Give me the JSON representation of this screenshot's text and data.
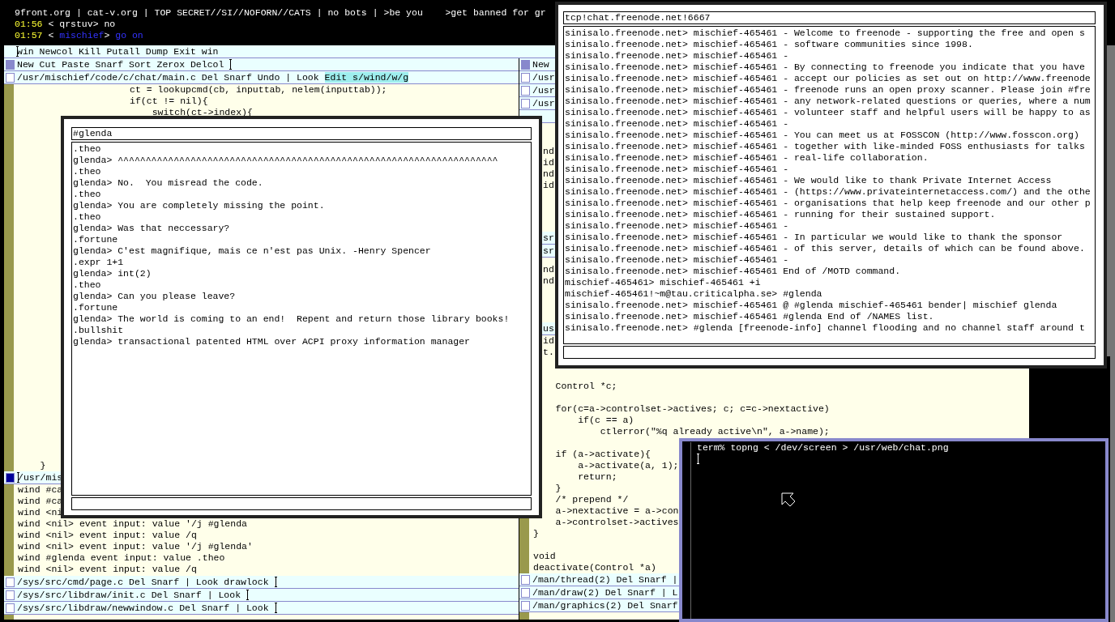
{
  "status_window": {
    "lines": [
      {
        "kind": "topic",
        "text": "9front.org | cat-v.org | TOP SECRET//SI//NOFORN//CATS | no bots | >be you    >get banned for gr"
      },
      {
        "kind": "message",
        "time": "01:56",
        "open": "<",
        "nick": "qrstuv",
        "close": ">",
        "text": "no",
        "self": false
      },
      {
        "kind": "message",
        "time": "01:57",
        "open": "<",
        "nick": "mischief",
        "close": ">",
        "text": "go on",
        "self": true
      }
    ]
  },
  "acme": {
    "tag": {
      "text": "win Newcol Kill Putall Dump Exit win",
      "cursor_before": true
    },
    "columns": [
      {
        "tag": {
          "text": "New Cut Paste Snarf Sort Zerox Delcol",
          "cursor_after": true
        },
        "windows": [
          {
            "tag": {
              "text": "/usr/mischief/code/c/chat/main.c Del Snarf Undo | Look",
              "selection": "Edit s/wind/w/g"
            },
            "dirty": false,
            "lines": [
              "\t\t\t\t\tct = lookupcmd(cb, inputtab, nelem(inputtab));",
              "\t\t\t\t\tif(ct != nil){",
              "\t\t\t\t\t\tswitch(ct->index){"
            ],
            "lines_below": [
              "\t}"
            ]
          },
          {
            "tag": {
              "text": "/usr/mis",
              "cursor_before": true
            },
            "dirty": true,
            "lines": [
              "wind #ca",
              "wind #ca",
              "wind <ni",
              "wind <nil> event input: value '/j #glenda",
              "wind <nil> event input: value /q",
              "wind <nil> event input: value '/j #glenda'",
              "wind #glenda event input: value .theo",
              "wind <nil> event input: value /q"
            ]
          },
          {
            "tag": {
              "text": "/sys/src/cmd/page.c Del Snarf | Look drawlock",
              "cursor_after": true
            },
            "dirty": false
          },
          {
            "tag": {
              "text": "/sys/src/libdraw/init.c Del Snarf | Look",
              "cursor_after": true
            },
            "dirty": false
          },
          {
            "tag": {
              "text": "/sys/src/libdraw/newwindow.c Del Snarf | Look",
              "cursor_after": true
            },
            "dirty": false
          }
        ]
      },
      {
        "tag": {
          "text": "New"
        },
        "windows": [
          {
            "tag": {
              "text": "/usr"
            },
            "dirty": false
          },
          {
            "tag": {
              "text": "/usr"
            },
            "dirty": false
          },
          {
            "tag": {
              "text": "/usr"
            },
            "dirty": false
          },
          {
            "lines": [
              {
                "kind": "fragment",
                "text": "nd"
              },
              {
                "kind": "fragment",
                "text": "id"
              },
              {
                "kind": "fragment",
                "text": "nd"
              },
              {
                "kind": "fragment",
                "text": "id"
              }
            ]
          },
          {
            "tag": {
              "text": "sr"
            }
          },
          {
            "tag": {
              "text": "sr"
            },
            "lines": [
              {
                "kind": "fragment",
                "text": "nd"
              },
              {
                "kind": "fragment",
                "text": "nd"
              }
            ]
          },
          {
            "tag": {
              "text": "us"
            },
            "lines": [
              {
                "kind": "fragment",
                "text": "id"
              },
              {
                "kind": "fragment",
                "text": "t."
              },
              {
                "kind": "blank"
              },
              {
                "kind": "blank"
              },
              {
                "kind": "code",
                "text": "\tControl *c;"
              },
              {
                "kind": "blank"
              },
              {
                "kind": "code",
                "text": "\tfor(c=a->controlset->actives; c; c=c->nextactive)"
              },
              {
                "kind": "code",
                "text": "\t\tif(c == a)"
              },
              {
                "kind": "code",
                "text": "\t\t\tctlerror(\"%q already active\\n\", a->name);"
              },
              {
                "kind": "blank"
              },
              {
                "kind": "code",
                "text": "\tif (a->activate){"
              },
              {
                "kind": "code",
                "text": "\t\ta->activate(a, 1);"
              },
              {
                "kind": "code",
                "text": "\t\treturn;"
              },
              {
                "kind": "code",
                "text": "\t}"
              },
              {
                "kind": "code",
                "text": "\t/* prepend */"
              },
              {
                "kind": "code",
                "text": "\ta->nextactive = a->con"
              },
              {
                "kind": "code",
                "text": "\ta->controlset->actives"
              },
              {
                "kind": "code",
                "text": "}"
              },
              {
                "kind": "blank"
              },
              {
                "kind": "code",
                "text": "void"
              },
              {
                "kind": "code",
                "text": "deactivate(Control *a)"
              }
            ]
          },
          {
            "tag": {
              "text": "/man/thread(2) Del Snarf |"
            },
            "dirty": false
          },
          {
            "tag": {
              "text": "/man/draw(2) Del Snarf | L"
            },
            "dirty": false
          },
          {
            "tag": {
              "text": "/man/graphics(2) Del Snarf"
            },
            "dirty": false
          }
        ]
      }
    ]
  },
  "glenda_window": {
    "title": "#glenda",
    "lines": [
      ".theo",
      "glenda> ^^^^^^^^^^^^^^^^^^^^^^^^^^^^^^^^^^^^^^^^^^^^^^^^^^^^^^^^^^^^^^^^^^^^",
      ".theo",
      "glenda> No.  You misread the code.",
      ".theo",
      "glenda> You are completely missing the point.",
      ".theo",
      "glenda> Was that neccessary?",
      ".fortune",
      "glenda> C'est magnifique, mais ce n'est pas Unix. -Henry Spencer",
      ".expr 1+1",
      "glenda> int(2)",
      ".theo",
      "glenda> Can you please leave?",
      ".fortune",
      "glenda> The world is coming to an end!  Repent and return those library books!",
      ".bullshit",
      "glenda> transactional patented HTML over ACPI proxy information manager"
    ]
  },
  "server_window": {
    "title": "tcp!chat.freenode.net!6667",
    "lines": [
      "sinisalo.freenode.net> mischief-465461 - Welcome to freenode - supporting the free and open s",
      "sinisalo.freenode.net> mischief-465461 - software communities since 1998.",
      "sinisalo.freenode.net> mischief-465461 -",
      "sinisalo.freenode.net> mischief-465461 - By connecting to freenode you indicate that you have",
      "sinisalo.freenode.net> mischief-465461 - accept our policies as set out on http://www.freenode",
      "sinisalo.freenode.net> mischief-465461 - freenode runs an open proxy scanner. Please join #fre",
      "sinisalo.freenode.net> mischief-465461 - any network-related questions or queries, where a num",
      "sinisalo.freenode.net> mischief-465461 - volunteer staff and helpful users will be happy to as",
      "sinisalo.freenode.net> mischief-465461 -",
      "sinisalo.freenode.net> mischief-465461 - You can meet us at FOSSCON (http://www.fosscon.org)",
      "sinisalo.freenode.net> mischief-465461 - together with like-minded FOSS enthusiasts for talks",
      "sinisalo.freenode.net> mischief-465461 - real-life collaboration.",
      "sinisalo.freenode.net> mischief-465461 -",
      "sinisalo.freenode.net> mischief-465461 - We would like to thank Private Internet Access",
      "sinisalo.freenode.net> mischief-465461 - (https://www.privateinternetaccess.com/) and the othe",
      "sinisalo.freenode.net> mischief-465461 - organisations that help keep freenode and our other p",
      "sinisalo.freenode.net> mischief-465461 - running for their sustained support.",
      "sinisalo.freenode.net> mischief-465461 -",
      "sinisalo.freenode.net> mischief-465461 - In particular we would like to thank the sponsor",
      "sinisalo.freenode.net> mischief-465461 - of this server, details of which can be found above.",
      "sinisalo.freenode.net> mischief-465461 -",
      "sinisalo.freenode.net> mischief-465461 End of /MOTD command.",
      "mischief-465461> mischief-465461 +i",
      "mischief-465461!~m@tau.criticalpha.se> #glenda",
      "sinisalo.freenode.net> mischief-465461 @ #glenda mischief-465461 bender| mischief glenda",
      "sinisalo.freenode.net> mischief-465461 #glenda End of /NAMES list.",
      "sinisalo.freenode.net> #glenda [freenode-info] channel flooding and no channel staff around t"
    ]
  },
  "terminal": {
    "lines": [
      "term% topng < /dev/screen > /usr/web/chat.png"
    ]
  }
}
